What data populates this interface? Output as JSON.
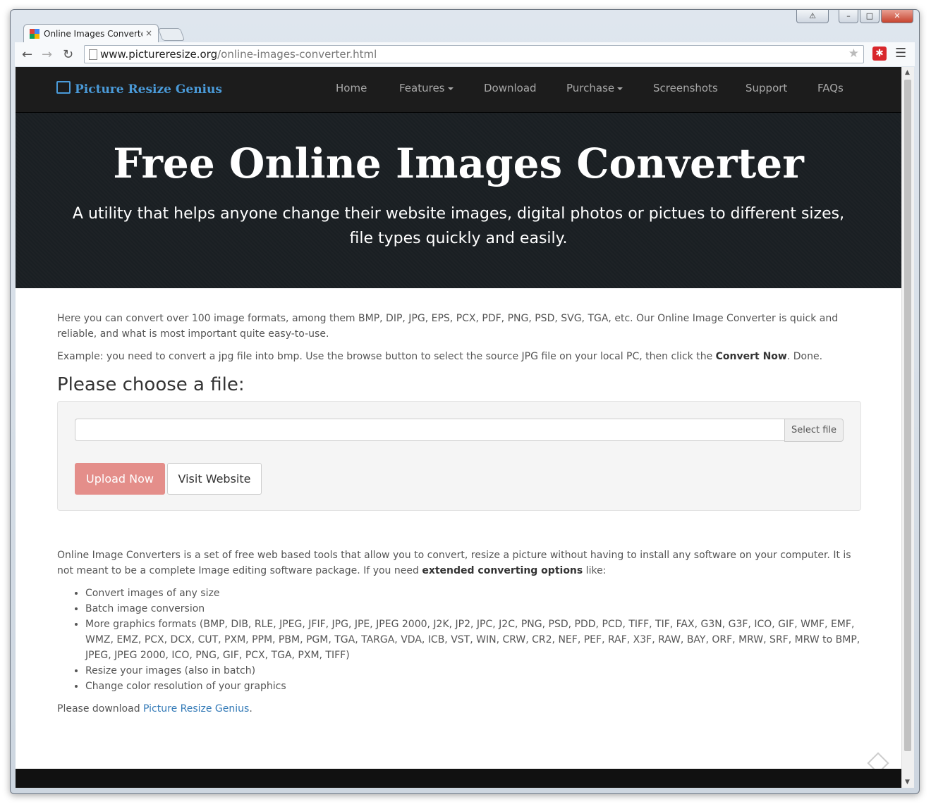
{
  "browser": {
    "tab_title": "Online Images Converter",
    "tab_close": "×",
    "url_host": "www.pictureresize.org",
    "url_path": "/online-images-converter.html",
    "icons": [
      "back-icon",
      "forward-icon",
      "reload-icon",
      "star-icon",
      "extension-icon",
      "menu-icon"
    ]
  },
  "navbar": {
    "brand": "Picture Resize Genius",
    "links": [
      "Home",
      "Features",
      "Download",
      "Purchase",
      "Screenshots",
      "Support",
      "FAQs"
    ]
  },
  "hero": {
    "title": "Free Online Images Converter",
    "subtitle": "A utility that helps anyone change their website images, digital photos or pictues to different sizes, file types quickly and easily."
  },
  "intro": {
    "p1": "Here you can convert over 100 image formats, among them BMP, DIP, JPG, EPS, PCX, PDF, PNG, PSD, SVG, TGA, etc. Our Online Image Converter is quick and reliable, and what is most important quite easy-to-use.",
    "p2_before": "Example: you need to convert a jpg file into bmp. Use the browse button to select the source JPG file on your local PC, then click the ",
    "p2_bold": "Convert Now",
    "p2_after": ". Done."
  },
  "form": {
    "heading": "Please choose a file:",
    "file_value": "",
    "select_file": "Select file",
    "upload": "Upload Now",
    "visit": "Visit Website"
  },
  "about": {
    "p_before": "Online Image Converters is a set of free web based tools that allow you to convert, resize a picture without having to install any software on your computer. It is not meant to be a complete Image editing software package. If you need ",
    "p_bold": "extended converting options",
    "p_after": " like:",
    "items": [
      "Convert images of any size",
      "Batch image conversion",
      "More graphics formats (BMP, DIB, RLE, JPEG, JFIF, JPG, JPE, JPEG 2000, J2K, JP2, JPC, J2C, PNG, PSD, PDD, PCD, TIFF, TIF, FAX, G3N, G3F, ICO, GIF, WMF, EMF, WMZ, EMZ, PCX, DCX, CUT, PXM, PPM, PBM, PGM, TGA, TARGA, VDA, ICB, VST, WIN, CRW, CR2, NEF, PEF, RAF, X3F, RAW, BAY, ORF, MRW, SRF, MRW to BMP, JPEG, JPEG 2000, ICO, PNG, GIF, PCX, TGA, PXM, TIFF)",
      "Resize your images (also in batch)",
      "Change color resolution of your graphics"
    ],
    "download_before": "Please download ",
    "download_link": "Picture Resize Genius",
    "download_after": "."
  },
  "colors": {
    "navbar_bg": "#1c1c1c",
    "brand": "#4a9ad8",
    "hero_bg": "#1a1f23",
    "upload_button": "#e48e8a",
    "link": "#337ab7"
  }
}
